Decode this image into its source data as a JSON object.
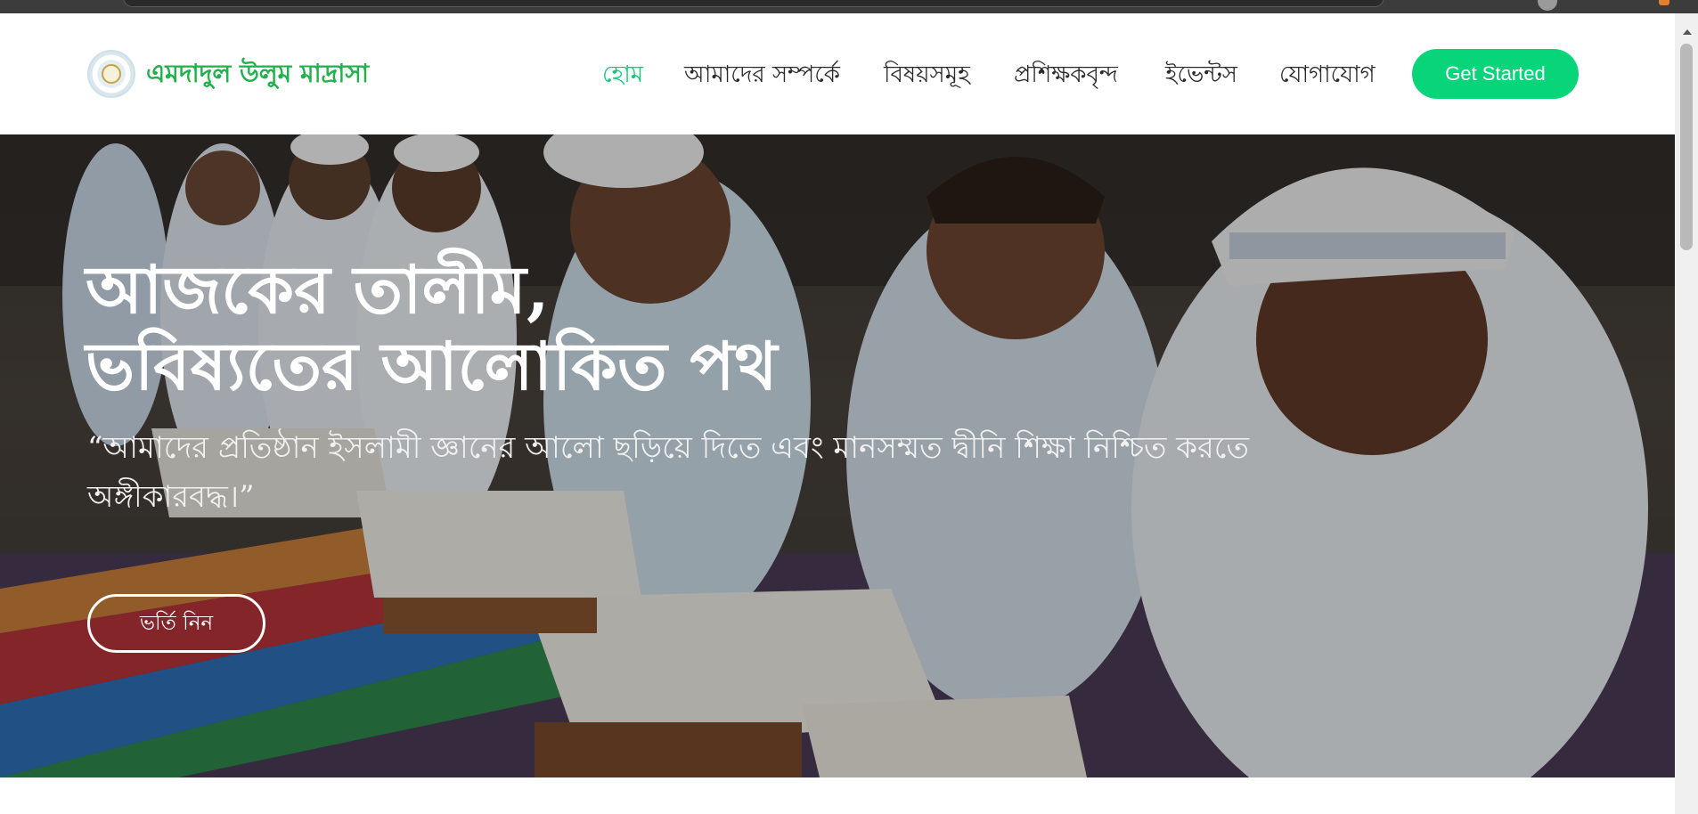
{
  "site": {
    "name": "এমদাদুল উলুম মাদ্রাসা",
    "logo_icon": "madrasa-emblem-icon"
  },
  "nav": {
    "items": [
      {
        "label": "হোম",
        "active": true
      },
      {
        "label": "আমাদের সম্পর্কে",
        "active": false
      },
      {
        "label": "বিষয়সমূহ",
        "active": false
      },
      {
        "label": "প্রশিক্ষকবৃন্দ",
        "active": false
      },
      {
        "label": "ইভেন্টস",
        "active": false
      },
      {
        "label": "যোগাযোগ",
        "active": false
      }
    ],
    "cta_label": "Get Started"
  },
  "hero": {
    "title_line1": "আজকের তালীম,",
    "title_line2": "ভবিষ্যতের আলোকিত পথ",
    "subtitle": "“আমাদের প্রতিষ্ঠান ইসলামী জ্ঞানের আলো ছড়িয়ে দিতে এবং মানসম্মত দ্বীনি শিক্ষা নিশ্চিত করতে অঙ্গীকারবদ্ধ।”",
    "button_label": "ভর্তি নিন",
    "background_image": "students-reading-quran-photo"
  },
  "colors": {
    "brand_green": "#22b14c",
    "active_nav": "#10c977",
    "cta_background": "#08d47a",
    "nav_text": "#2a2a2a"
  }
}
